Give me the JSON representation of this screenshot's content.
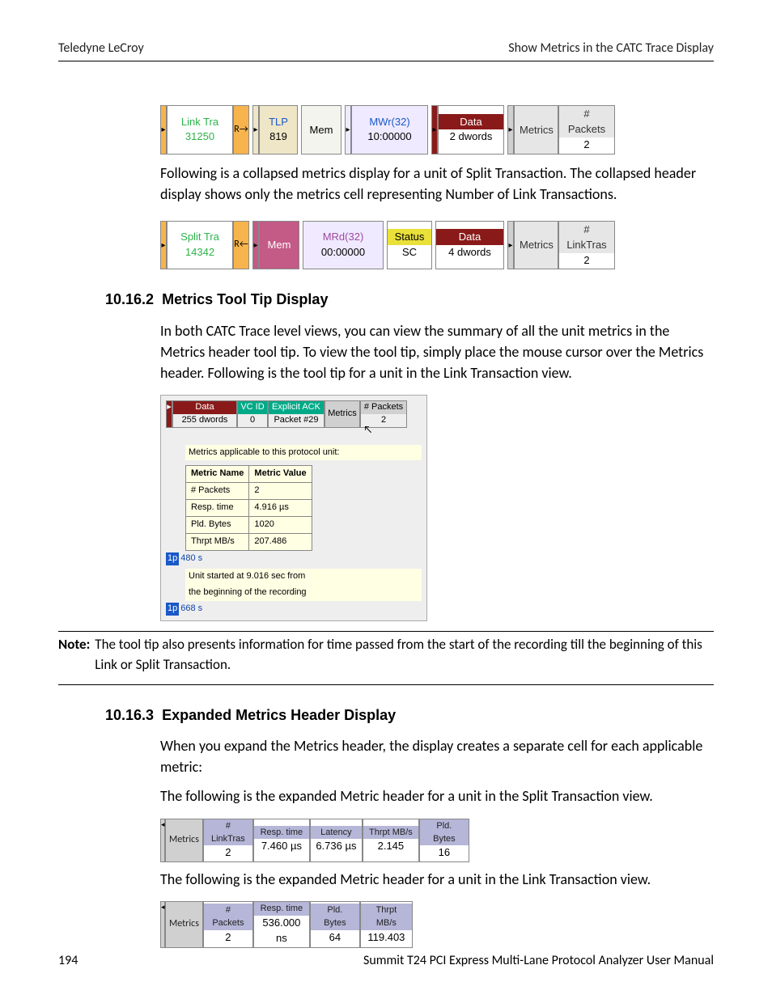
{
  "header": {
    "left": "Teledyne LeCroy",
    "right": "Show Metrics in the CATC Trace Display"
  },
  "fig1": {
    "linktra": {
      "top": "Link Tra",
      "bot": "31250"
    },
    "rarrow": "R→",
    "tlp": {
      "top": "TLP",
      "bot": "819"
    },
    "mem": "Mem",
    "mwr": {
      "top": "MWr(32)",
      "bot": "10:00000"
    },
    "data": {
      "top": "Data",
      "bot": "2  dwords"
    },
    "metrics": "Metrics",
    "packets": {
      "top": "# Packets",
      "bot": "2"
    }
  },
  "para1": "Following is a collapsed metrics display for a unit of Split Transaction. The collapsed header display shows only the metrics cell representing Number of Link Transactions.",
  "fig2": {
    "split": {
      "top": "Split Tra",
      "bot": "14342"
    },
    "rarrow": "R←",
    "mem": "Mem",
    "mrd": {
      "top": "MRd(32)",
      "bot": "00:00000"
    },
    "status": {
      "top": "Status",
      "bot": "SC"
    },
    "data": {
      "top": "Data",
      "bot": "4  dwords"
    },
    "metrics": "Metrics",
    "linktras": {
      "top": "# LinkTras",
      "bot": "2"
    }
  },
  "s2": {
    "num": "10.16.2",
    "title": "Metrics Tool Tip Display",
    "para": "In both CATC Trace level views, you can view the summary of all the unit metrics in the Metrics header tool tip. To view the tool tip, simply place the mouse cursor over the Metrics header. Following is the tool tip for a unit in the Link Transaction view."
  },
  "tt": {
    "strip": {
      "data": {
        "top": "Data",
        "bot": "255 dwords"
      },
      "vcid": {
        "top": "VC ID",
        "bot": "0"
      },
      "ack": {
        "top": "Explicit ACK",
        "bot": "Packet #29"
      },
      "metrics": "Metrics",
      "packets": {
        "top": "# Packets",
        "bot": "2"
      }
    },
    "caption": "Metrics applicable to this protocol unit:",
    "th1": "Metric Name",
    "th2": "Metric Value",
    "rows": [
      {
        "n": "# Packets",
        "v": "2"
      },
      {
        "n": "Resp. time",
        "v": "4.916 µs"
      },
      {
        "n": "Pld. Bytes",
        "v": "1020"
      },
      {
        "n": "Thrpt MB/s",
        "v": "207.486"
      }
    ],
    "foot1": "Unit started at  9.016 sec from",
    "foot2": "the beginning of the recording",
    "stub1l": "1p",
    "stub1r": "480 s",
    "stub2l": "1p",
    "stub2r": "668 s"
  },
  "note": {
    "label": "Note:",
    "text": "The tool tip also presents information for time passed from the start of the recording till the beginning of this Link or Split Transaction."
  },
  "s3": {
    "num": "10.16.3",
    "title": "Expanded Metrics Header Display",
    "para1": "When you expand the Metrics header, the display creates a separate cell for each applicable metric:",
    "para2": "The following is the expanded Metric header for a unit in the Split Transaction view.",
    "para3": "The following is the expanded Metric header for a unit in the Link Transaction view."
  },
  "exp1": {
    "metrics": "Metrics",
    "cols": [
      {
        "h": "# LinkTras",
        "v": "2"
      },
      {
        "h": "Resp. time",
        "v": "7.460 µs"
      },
      {
        "h": "Latency",
        "v": "6.736 µs"
      },
      {
        "h": "Thrpt MB/s",
        "v": "2.145"
      },
      {
        "h": "Pld. Bytes",
        "v": "16"
      }
    ]
  },
  "exp2": {
    "metrics": "Metrics",
    "cols": [
      {
        "h": "# Packets",
        "v": "2"
      },
      {
        "h": "Resp. time",
        "v": "536.000 ns"
      },
      {
        "h": "Pld. Bytes",
        "v": "64"
      },
      {
        "h": "Thrpt MB/s",
        "v": "119.403"
      }
    ]
  },
  "footer": {
    "left": "194",
    "right": "Summit T24 PCI Express Multi-Lane Protocol Analyzer User Manual"
  }
}
